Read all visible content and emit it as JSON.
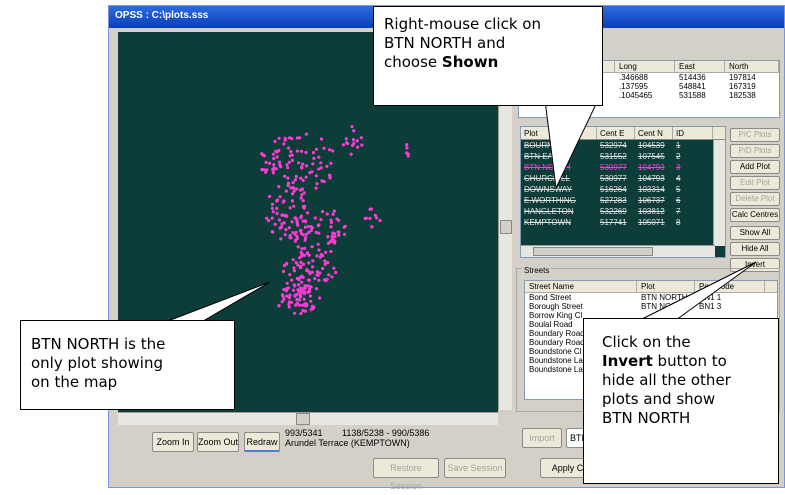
{
  "window": {
    "title": "OPSS : C:\\plots.sss"
  },
  "top_grid": {
    "columns": [
      "Long",
      "East",
      "North"
    ],
    "rows": [
      [
        ".346688",
        "514436",
        "197814"
      ],
      [
        ".137595",
        "548841",
        "167319"
      ],
      [
        ".1045465",
        "531588",
        "182538"
      ]
    ]
  },
  "plots_list": {
    "columns": [
      "Plot",
      "Cent E",
      "Cent N",
      "ID"
    ],
    "rows": [
      {
        "plot": "BOURNE",
        "cent_e": "532974",
        "cent_n": "104539",
        "id": "1"
      },
      {
        "plot": "BTN EAST",
        "cent_e": "531552",
        "cent_n": "107545",
        "id": "2"
      },
      {
        "plot": "BTN NORTH",
        "cent_e": "530977",
        "cent_n": "104793",
        "id": "3"
      },
      {
        "plot": "CHURCHILL",
        "cent_e": "530977",
        "cent_n": "104793",
        "id": "4"
      },
      {
        "plot": "DOWNSWAY",
        "cent_e": "516264",
        "cent_n": "103314",
        "id": "5"
      },
      {
        "plot": "E.WORTHING",
        "cent_e": "527283",
        "cent_n": "106737",
        "id": "6"
      },
      {
        "plot": "HANGLETON",
        "cent_e": "532269",
        "cent_n": "103812",
        "id": "7"
      },
      {
        "plot": "KEMPTOWN",
        "cent_e": "517741",
        "cent_n": "105071",
        "id": "8"
      }
    ]
  },
  "side_buttons": [
    {
      "label": "P/C Plots",
      "enabled": false
    },
    {
      "label": "P/D Plots",
      "enabled": false
    },
    {
      "label": "Add Plot",
      "enabled": true
    },
    {
      "label": "Edit Plot",
      "enabled": false
    },
    {
      "label": "Delete Plot",
      "enabled": false
    },
    {
      "label": "Calc Centres",
      "enabled": true
    },
    {
      "label": "Show All",
      "enabled": true
    },
    {
      "label": "Hide All",
      "enabled": true
    },
    {
      "label": "Invert",
      "enabled": true
    }
  ],
  "streets": {
    "title": "Streets",
    "columns": [
      "Street Name",
      "Plot",
      "PostCode"
    ],
    "rows": [
      [
        "Bond Street",
        "BTN NORTH",
        "BN1 1"
      ],
      [
        "Borough Street",
        "BTN NORTH",
        "BN1 3"
      ],
      [
        "Borrow King Cl",
        "",
        ""
      ],
      [
        "Boulal Road",
        "",
        ""
      ],
      [
        "Boundary Road",
        "",
        ""
      ],
      [
        "Boundary Road",
        "",
        ""
      ],
      [
        "Boundstone Cl",
        "",
        ""
      ],
      [
        "Boundstone La",
        "",
        ""
      ],
      [
        "Boundstone La",
        "",
        ""
      ]
    ]
  },
  "bottom": {
    "zoom_in": "Zoom In",
    "zoom_out": "Zoom Out",
    "redraw": "Redraw",
    "coords_a": "993/5341",
    "coords_b": "1138/5238 - 990/5386",
    "location": "Arundel Terrace (KEMPTOWN)",
    "restore": "Restore Session",
    "save": "Save Session",
    "apply": "Apply Ch",
    "import": "Import",
    "btn_field": "BTN"
  },
  "callouts": {
    "top_line1": "Right-mouse click on",
    "top_line2": "BTN NORTH and",
    "top_line3": "choose ",
    "top_bold": "Shown",
    "left_line1": "BTN NORTH is the",
    "left_line2": "only plot showing",
    "left_line3": "on the map",
    "right_line1": "Click on the",
    "right_bold": "Invert",
    "right_line2": " button to",
    "right_line3": "hide all the other",
    "right_line4": "plots and show",
    "right_line5": "BTN NORTH"
  },
  "colors": {
    "map_bg": "#0d3d38",
    "highlight": "#ff3bd6"
  }
}
